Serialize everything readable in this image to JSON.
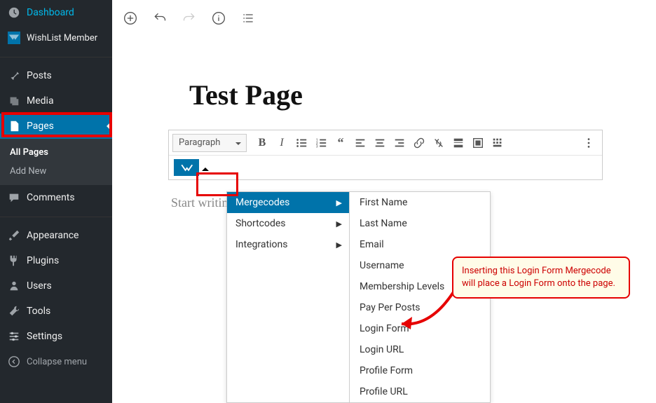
{
  "sidebar": {
    "dashboard": "Dashboard",
    "wishlist": "WishList Member",
    "posts": "Posts",
    "media": "Media",
    "pages": "Pages",
    "all_pages": "All Pages",
    "add_new": "Add New",
    "comments": "Comments",
    "appearance": "Appearance",
    "plugins": "Plugins",
    "users": "Users",
    "tools": "Tools",
    "settings": "Settings",
    "collapse": "Collapse menu"
  },
  "page": {
    "title": "Test Page",
    "placeholder": "Start writing or type / t"
  },
  "toolbar": {
    "paragraph": "Paragraph"
  },
  "dd_cats": [
    "Mergecodes",
    "Shortcodes",
    "Integrations"
  ],
  "dd_items": [
    "First Name",
    "Last Name",
    "Email",
    "Username",
    "Membership Levels",
    "Pay Per Posts",
    "Login Form",
    "Login URL",
    "Profile Form",
    "Profile URL"
  ],
  "callout": "Inserting this Login Form Mergecode will place a Login Form onto the page."
}
